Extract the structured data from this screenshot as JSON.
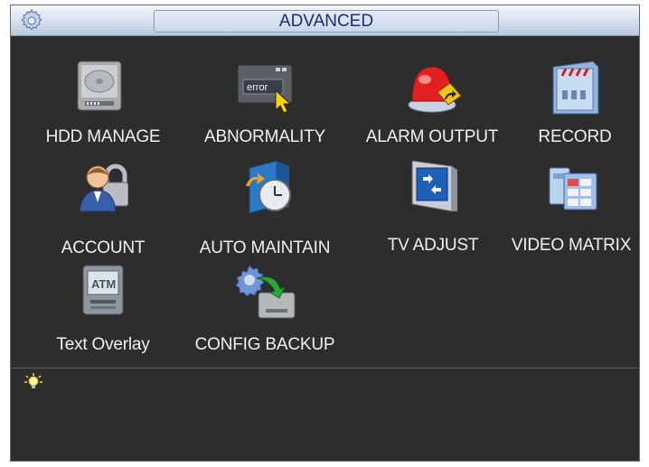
{
  "window": {
    "title": "ADVANCED"
  },
  "menu": {
    "items": [
      {
        "label": "HDD MANAGE",
        "icon": "hard-drive-icon"
      },
      {
        "label": "ABNORMALITY",
        "icon": "error-icon"
      },
      {
        "label": "ALARM OUTPUT",
        "icon": "alarm-light-icon"
      },
      {
        "label": "RECORD",
        "icon": "record-panel-icon"
      },
      {
        "label": "ACCOUNT",
        "icon": "account-lock-icon"
      },
      {
        "label": "AUTO MAINTAIN",
        "icon": "auto-maintain-icon"
      },
      {
        "label": "TV ADJUST",
        "icon": "tv-adjust-icon"
      },
      {
        "label": "VIDEO MATRIX",
        "icon": "video-matrix-icon"
      },
      {
        "label": "Text Overlay",
        "icon": "atm-icon"
      },
      {
        "label": "CONFIG BACKUP",
        "icon": "config-backup-icon"
      }
    ],
    "error_badge": "error",
    "atm_badge": "ATM"
  },
  "colors": {
    "background": "#2d2d2d",
    "label": "#f0f0f0",
    "title_text": "#1b2c7a"
  }
}
